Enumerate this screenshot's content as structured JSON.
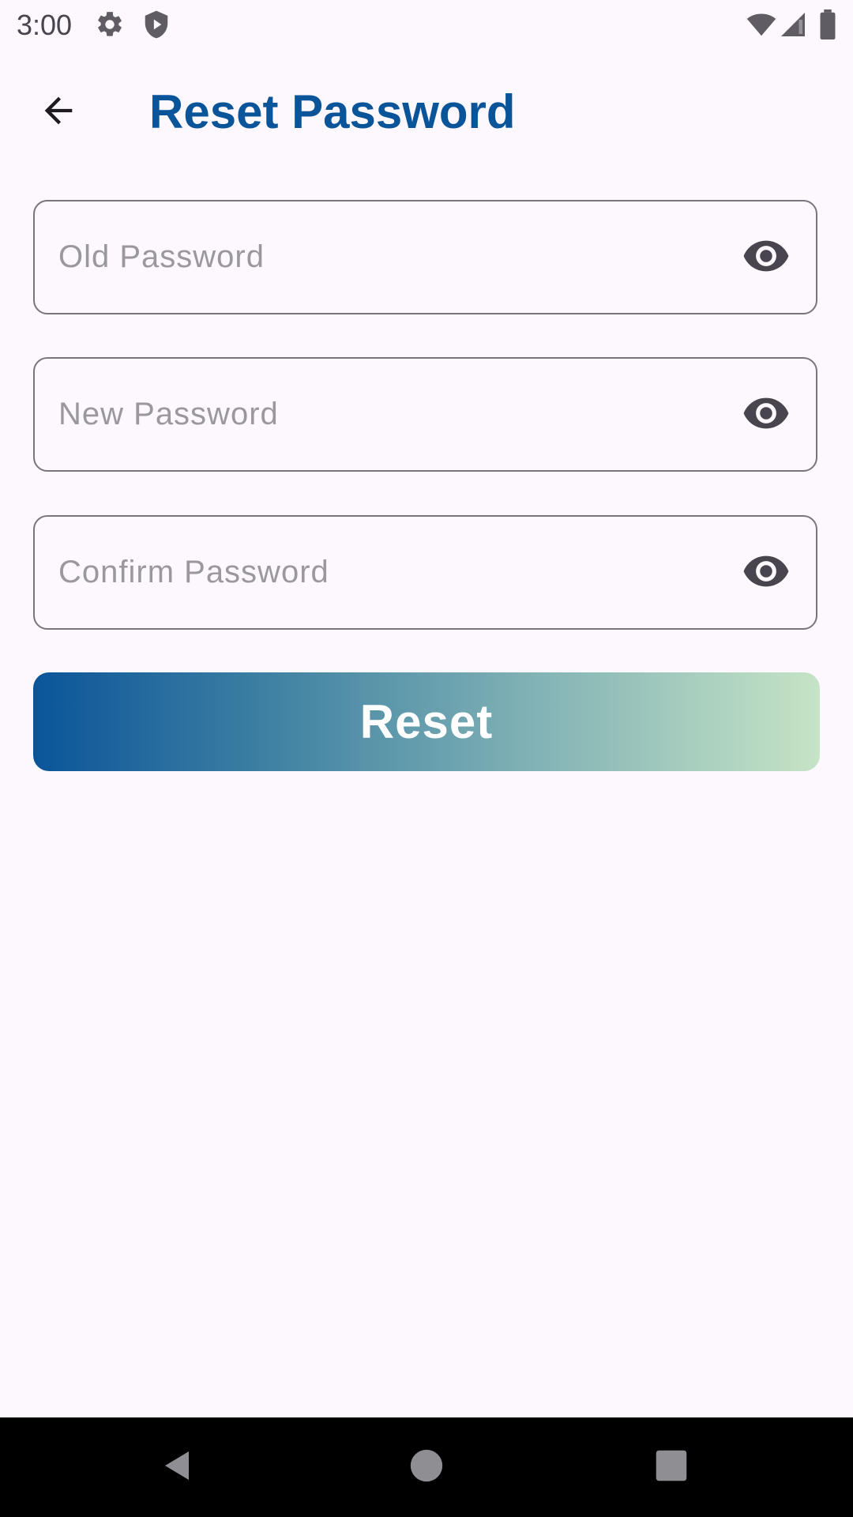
{
  "status_bar": {
    "time": "3:00",
    "icons": [
      "gear-icon",
      "shield-icon",
      "wifi-icon",
      "cell-signal-icon",
      "battery-icon"
    ]
  },
  "app_bar": {
    "back_icon": "arrow-left-icon",
    "title": "Reset Password",
    "title_color": "#0a5599"
  },
  "form": {
    "old_password": {
      "placeholder": "Old Password",
      "value": "",
      "toggle_icon": "eye-icon"
    },
    "new_password": {
      "placeholder": "New Password",
      "value": "",
      "toggle_icon": "eye-icon"
    },
    "confirm_password": {
      "placeholder": "Confirm Password",
      "value": "",
      "toggle_icon": "eye-icon"
    }
  },
  "reset_button": {
    "label": "Reset",
    "gradient": [
      "#0a5599",
      "#c6e4c6"
    ]
  },
  "nav_bar": {
    "icons": [
      "back-triangle-icon",
      "home-circle-icon",
      "recents-square-icon"
    ]
  }
}
